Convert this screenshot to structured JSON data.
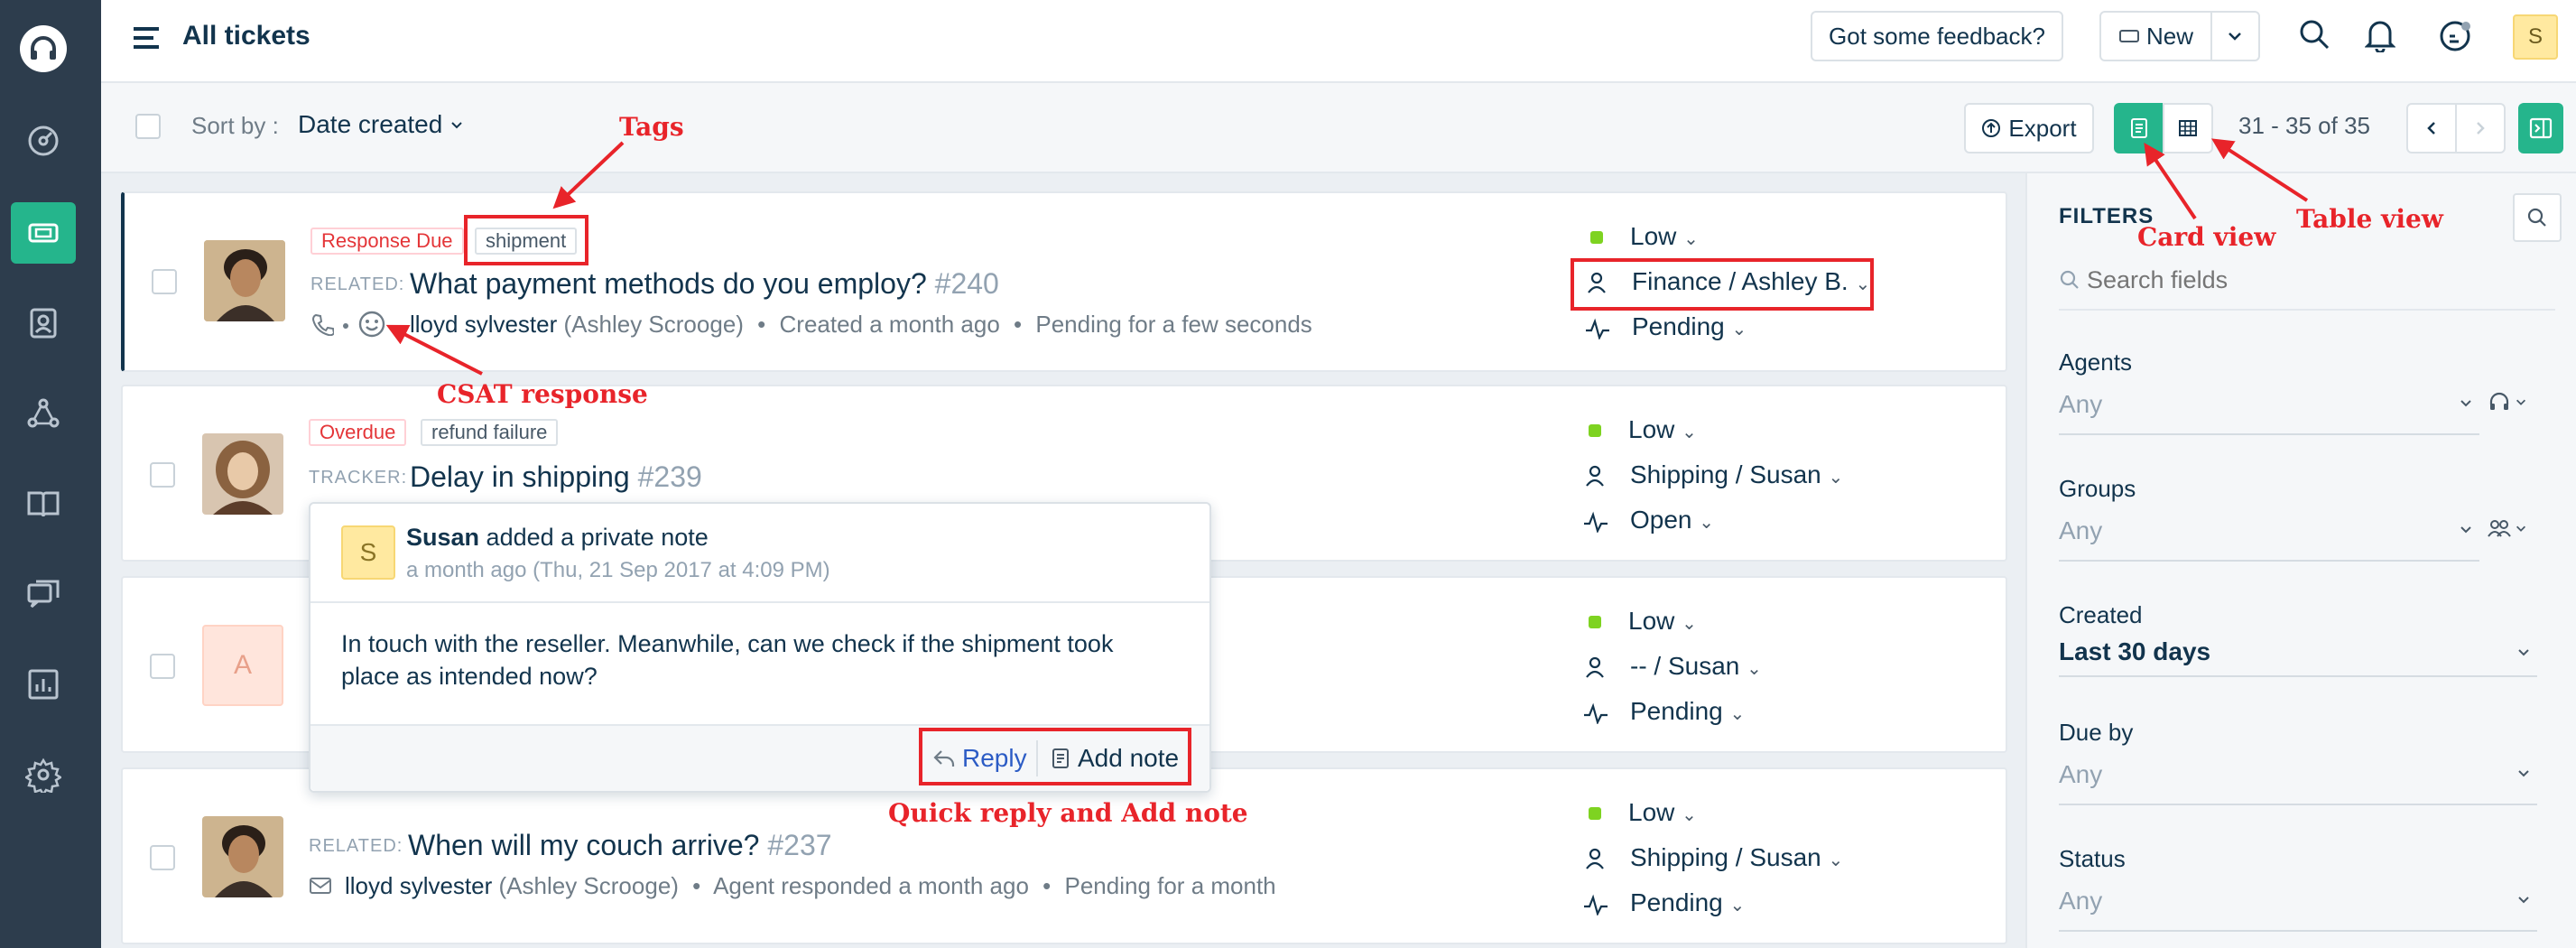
{
  "header": {
    "title": "All tickets",
    "feedback_label": "Got some feedback?",
    "new_label": "New",
    "avatar_letter": "S"
  },
  "toolbar": {
    "sort_by_label": "Sort by :",
    "sort_value": "Date created",
    "export_label": "Export",
    "pagination": "31 - 35 of 35"
  },
  "tickets": [
    {
      "badge": "Response Due",
      "tag": "shipment",
      "relation": "RELATED:",
      "subject": "What payment methods do you employ?",
      "number": "#240",
      "requester": "lloyd sylvester",
      "company": "(Ashley Scrooge)",
      "created": "Created a month ago",
      "status_note": "Pending for a few seconds",
      "priority": "Low",
      "assignee": "Finance / Ashley B.",
      "status": "Pending"
    },
    {
      "badge": "Overdue",
      "tag": "refund failure",
      "relation": "TRACKER:",
      "subject": "Delay in shipping",
      "number": "#239",
      "priority": "Low",
      "assignee": "Shipping / Susan",
      "status": "Open"
    },
    {
      "avatar_letter": "A",
      "priority": "Low",
      "assignee": "-- / Susan",
      "status": "Pending"
    },
    {
      "relation": "RELATED:",
      "subject": "When will my couch arrive?",
      "number": "#237",
      "requester": "lloyd sylvester",
      "company": "(Ashley Scrooge)",
      "created": "Agent responded a month ago",
      "status_note": "Pending for a month",
      "priority": "Low",
      "assignee": "Shipping / Susan",
      "status": "Pending"
    }
  ],
  "note_popover": {
    "avatar_letter": "S",
    "author": "Susan",
    "action": "added a private note",
    "time": "a month ago (Thu, 21 Sep 2017 at 4:09 PM)",
    "body_line1": "In touch with the reseller. Meanwhile, can we check if the shipment took",
    "body_line2": "place as intended now?",
    "reply_label": "Reply",
    "add_note_label": "Add note"
  },
  "filters": {
    "title": "FILTERS",
    "search_placeholder": "Search fields",
    "agents_label": "Agents",
    "agents_value": "Any",
    "groups_label": "Groups",
    "groups_value": "Any",
    "created_label": "Created",
    "created_value": "Last 30 days",
    "due_label": "Due by",
    "due_value": "Any",
    "status_label": "Status",
    "status_value": "Any"
  },
  "annotations": {
    "tags": "Tags",
    "csat": "CSAT response",
    "card_view": "Card view",
    "table_view": "Table view",
    "quick_reply": "Quick reply and Add note"
  },
  "colors": {
    "rail": "#2d3d4d",
    "accent": "#25b58c",
    "annotation": "#e8242a",
    "priority_low": "#7ed321"
  }
}
